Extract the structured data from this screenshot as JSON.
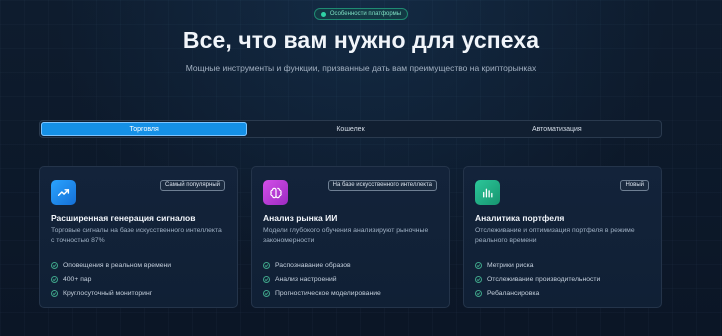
{
  "top_badge": {
    "label": "Особенности платформы",
    "icon": "sparkle-dot-icon"
  },
  "headline": "Все, что вам нужно для успеха",
  "subtitle": "Мощные инструменты и функции, призванные дать вам преимущество на крипторынках",
  "tabs": [
    {
      "label": "Торговля",
      "active": true
    },
    {
      "label": "Кошелек",
      "active": false
    },
    {
      "label": "Автоматизация",
      "active": false
    }
  ],
  "cards": [
    {
      "icon": "trending-up-icon",
      "icon_color": "#1e8fe8",
      "tag": "Самый популярный",
      "title": "Расширенная генерация сигналов",
      "description": "Торговые сигналы на базе искусственного интеллекта с точностью 87%",
      "features": [
        "Оповещения в реальном времени",
        "400+ пар",
        "Круглосуточный мониторинг"
      ]
    },
    {
      "icon": "brain-icon",
      "icon_color": "#c03ad6",
      "tag": "На базе искусственного интеллекта",
      "title": "Анализ рынка ИИ",
      "description": "Модели глубокого обучения анализируют рыночные закономерности",
      "features": [
        "Распознавание образов",
        "Анализ настроений",
        "Прогностическое моделирование"
      ]
    },
    {
      "icon": "bar-chart-icon",
      "icon_color": "#1fae86",
      "tag": "Новый",
      "title": "Аналитика портфеля",
      "description": "Отслеживание и оптимизация портфеля в режиме реального времени",
      "features": [
        "Метрики риска",
        "Отслеживание производительности",
        "Ребалансировка"
      ]
    }
  ],
  "colors": {
    "accent": "#1590e6",
    "check": "#3fa58a",
    "background": "#0c1829"
  }
}
